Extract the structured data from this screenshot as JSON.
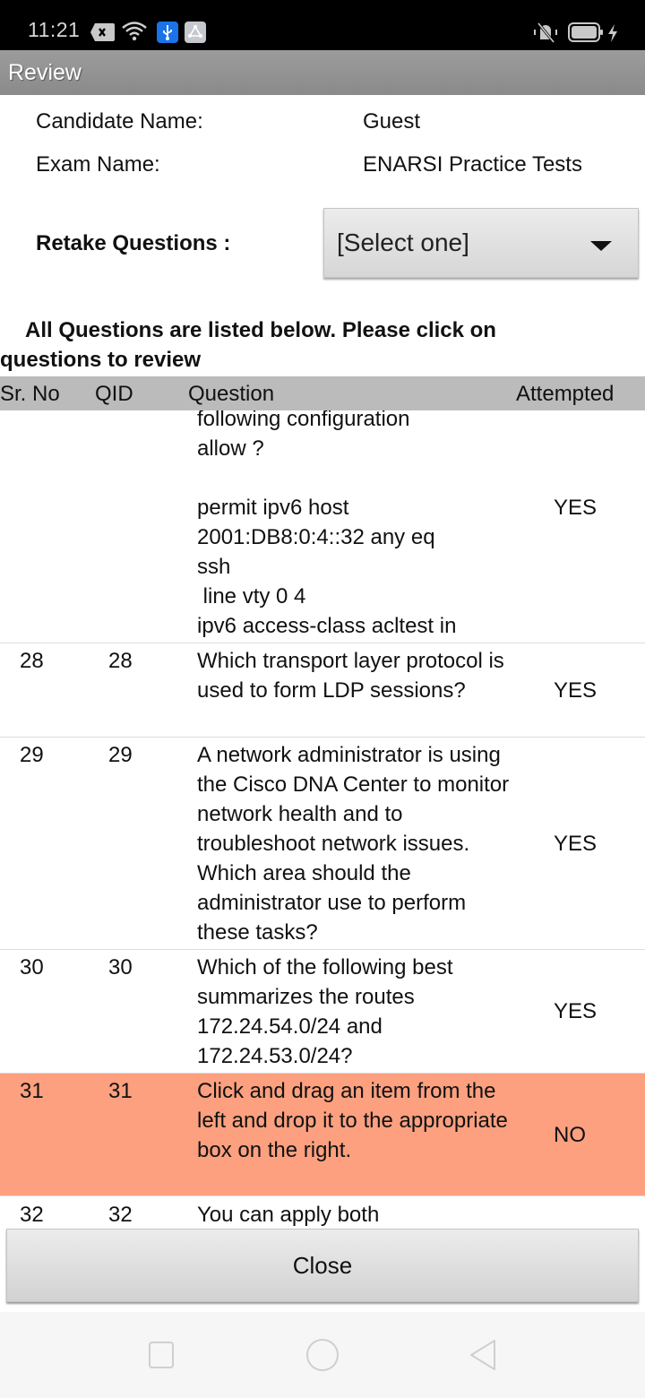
{
  "status_bar": {
    "time": "11:21",
    "icons": [
      "notification-x-icon",
      "wifi-icon",
      "usb-icon",
      "network-share-icon",
      "vibrate-off-icon",
      "battery-icon",
      "charging-icon"
    ]
  },
  "app": {
    "title": "Review"
  },
  "info": {
    "candidate_label": "Candidate Name:",
    "candidate_value": "Guest",
    "exam_label": "Exam Name:",
    "exam_value": "ENARSI Practice Tests"
  },
  "retake": {
    "label": "Retake Questions :",
    "selected": "[Select one]"
  },
  "instructions": "All Questions are listed below. Please click on questions to review",
  "table": {
    "headers": {
      "sr_no": "Sr. No",
      "qid": "QID",
      "question": "Question",
      "attempted": "Attempted"
    },
    "rows": [
      {
        "sr_no": "",
        "qid": "",
        "question": "following configuration\nallow ?\n\npermit ipv6 host\n2001:DB8:0:4::32 any eq\nssh\n line vty 0 4\nipv6 access-class acltest in",
        "attempted": "YES"
      },
      {
        "sr_no": "28",
        "qid": "28",
        "question": "Which transport layer protocol is used to form LDP sessions?",
        "attempted": "YES"
      },
      {
        "sr_no": "29",
        "qid": "29",
        "question": "A network administrator is using the Cisco DNA Center to monitor network health and to troubleshoot network issues. Which area should the administrator use to perform these tasks?",
        "attempted": "YES"
      },
      {
        "sr_no": "30",
        "qid": "30",
        "question": "Which of the following best summarizes the routes 172.24.54.0/24 and 172.24.53.0/24?",
        "attempted": "YES"
      },
      {
        "sr_no": "31",
        "qid": "31",
        "question": "Click and drag an item from the left and drop it to the appropriate box on the right.",
        "attempted": "NO"
      },
      {
        "sr_no": "32",
        "qid": "32",
        "question": "You can apply both",
        "attempted": ""
      }
    ]
  },
  "colors": {
    "not_attempted_row": "#fca07f",
    "header_bg": "#bbbbbb",
    "titlebar_bg": "#949494"
  },
  "footer": {
    "close_label": "Close"
  },
  "nav": {
    "recents": "recents-icon",
    "home": "home-icon",
    "back": "back-icon"
  }
}
